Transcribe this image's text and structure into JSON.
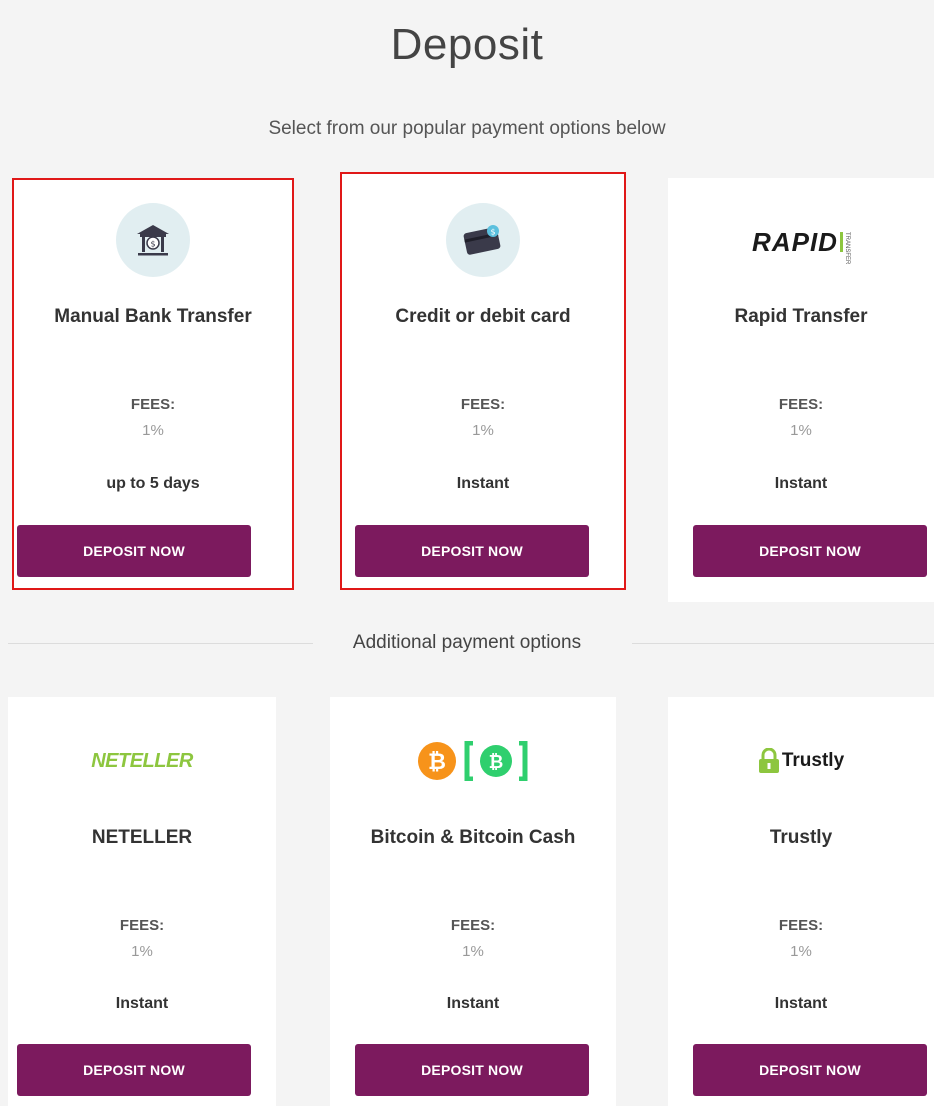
{
  "page": {
    "title": "Deposit",
    "subtitle": "Select from our popular payment options below",
    "additional_heading": "Additional payment options"
  },
  "colors": {
    "button": "#7c1a5e",
    "highlight": "#e01818",
    "icon_bg": "#e1eef1",
    "neteller": "#8dc63f",
    "bitcoin": "#f7931a",
    "bitcoin_cash": "#2fcf6e",
    "trustly": "#8dc63f"
  },
  "popular": [
    {
      "name": "Manual Bank Transfer",
      "icon": "bank-icon",
      "fees_label": "FEES:",
      "fees_value": "1%",
      "time": "up to 5 days",
      "button": "DEPOSIT NOW",
      "highlighted": true
    },
    {
      "name": "Credit or debit card",
      "icon": "credit-card-icon",
      "fees_label": "FEES:",
      "fees_value": "1%",
      "time": "Instant",
      "button": "DEPOSIT NOW",
      "highlighted": true
    },
    {
      "name": "Rapid Transfer",
      "icon": "rapid-transfer-logo",
      "logo_text": "RAPID",
      "logo_subtext": "TRANSFER",
      "fees_label": "FEES:",
      "fees_value": "1%",
      "time": "Instant",
      "button": "DEPOSIT NOW",
      "highlighted": false
    }
  ],
  "additional": [
    {
      "name": "NETELLER",
      "icon": "neteller-logo",
      "logo_text": "NETELLER",
      "fees_label": "FEES:",
      "fees_value": "1%",
      "time": "Instant",
      "button": "DEPOSIT NOW"
    },
    {
      "name": "Bitcoin & Bitcoin Cash",
      "icon": "bitcoin-logo",
      "fees_label": "FEES:",
      "fees_value": "1%",
      "time": "Instant",
      "button": "DEPOSIT NOW"
    },
    {
      "name": "Trustly",
      "icon": "trustly-logo",
      "logo_text": "Trustly",
      "fees_label": "FEES:",
      "fees_value": "1%",
      "time": "Instant",
      "button": "DEPOSIT NOW"
    }
  ]
}
